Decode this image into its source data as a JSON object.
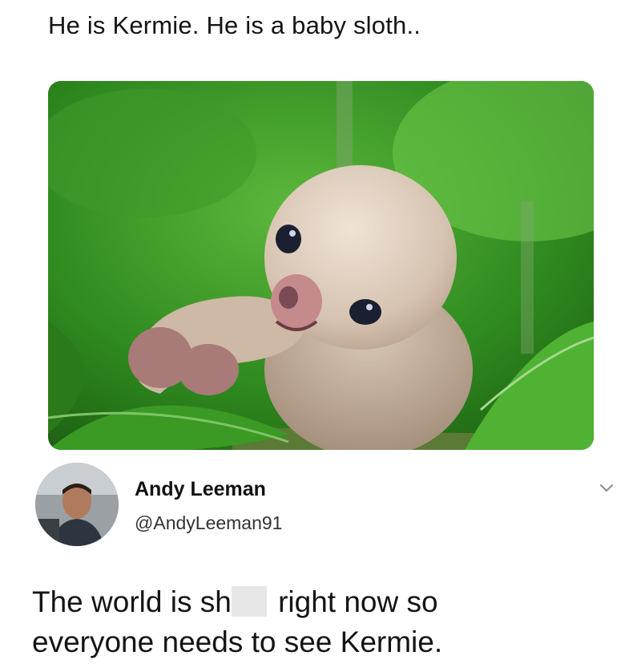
{
  "post": {
    "caption": "He is Kermie. He is a baby sloth..",
    "image_alt": "Baby sloth clinging to a branch among green leaves"
  },
  "tweet": {
    "display_name": "Andy Leeman",
    "handle": "@AndyLeeman91",
    "text_part1": "The world is sh",
    "text_part2": " right now so",
    "text_line2": "everyone needs to see Kermie."
  },
  "icons": {
    "menu": "chevron-down-icon"
  },
  "colors": {
    "leaf_green": "#3f9a2a",
    "sloth_fur": "#d8c7b6",
    "text": "#111111"
  }
}
